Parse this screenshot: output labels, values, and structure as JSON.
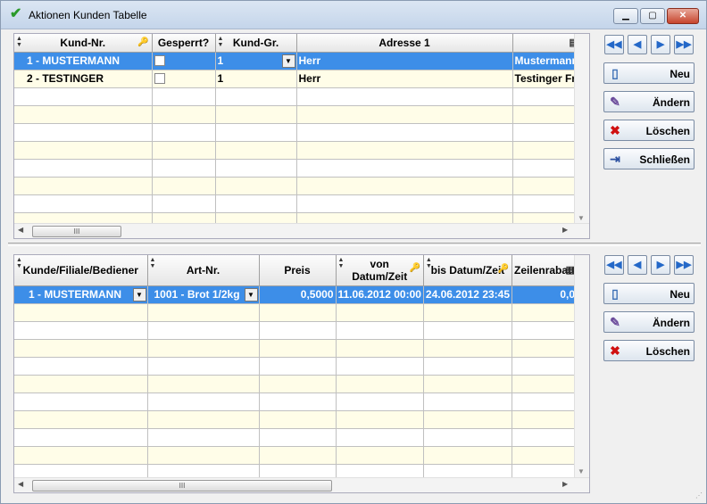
{
  "window": {
    "title": "Aktionen Kunden Tabelle",
    "min_label": "▁",
    "max_label": "▢",
    "close_label": "✕"
  },
  "grid1": {
    "columns": [
      "Kund-Nr.",
      "Gesperrt?",
      "Kund-Gr.",
      "Adresse 1",
      ""
    ],
    "rows": [
      {
        "kund_nr": "1 - MUSTERMANN",
        "gesperrt": false,
        "kund_gr": "1",
        "adresse1": "Herr",
        "adresse2": "Mustermann"
      },
      {
        "kund_nr": "2 - TESTINGER",
        "gesperrt": false,
        "kund_gr": "1",
        "adresse1": "Herr",
        "adresse2": "Testinger Fr"
      }
    ],
    "scroll_thumb": "III"
  },
  "grid2": {
    "columns": [
      "Kunde/Filiale/Bediener",
      "Art-Nr.",
      "Preis",
      "von Datum/Zeit",
      "bis Datum/Zeit",
      "Zeilenrabatt"
    ],
    "col_von_line1": "von",
    "col_von_line2": "Datum/Zeit",
    "rows": [
      {
        "kunde": "1 - MUSTERMANN",
        "art": "1001 - Brot 1/2kg",
        "preis": "0,5000",
        "von": "11.06.2012 00:00",
        "bis": "24.06.2012 23:45",
        "rabatt": "0,0"
      }
    ],
    "scroll_thumb": "III"
  },
  "buttons_top": {
    "neu": "Neu",
    "aendern": "Ändern",
    "loeschen": "Löschen",
    "schliessen": "Schließen"
  },
  "buttons_bottom": {
    "neu": "Neu",
    "aendern": "Ändern",
    "loeschen": "Löschen"
  },
  "nav_icons": [
    "first-icon",
    "prev-icon",
    "next-icon",
    "last-icon"
  ],
  "colors": {
    "selection": "#3d8ee8",
    "odd_row": "#fffde8"
  }
}
